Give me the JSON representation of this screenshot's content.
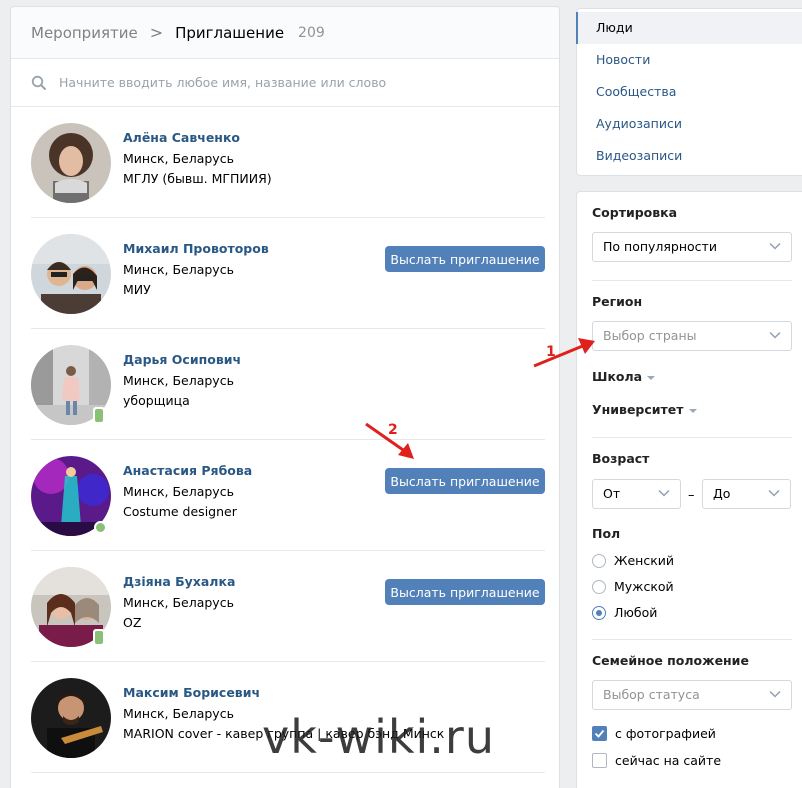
{
  "header": {
    "parent": "Мероприятие",
    "separator": ">",
    "current": "Приглашение",
    "count": "209"
  },
  "search": {
    "placeholder": "Начните вводить любое имя, название или слово"
  },
  "people": [
    {
      "name": "Алёна Савченко",
      "city": "Минск, Беларусь",
      "extra": "МГЛУ (бывш. МГПИИЯ)",
      "button": "",
      "badge": "none"
    },
    {
      "name": "Михаил Провоторов",
      "city": "Минск, Беларусь",
      "extra": "МИУ",
      "button": "Выслать приглашение",
      "badge": "none"
    },
    {
      "name": "Дарья Осипович",
      "city": "Минск, Беларусь",
      "extra": "уборщица",
      "button": "",
      "badge": "mobile"
    },
    {
      "name": "Анастасия Рябова",
      "city": "Минск, Беларусь",
      "extra": "Costume designer",
      "button": "Выслать приглашение",
      "badge": "online"
    },
    {
      "name": "Дзіяна Бухалка",
      "city": "Минск, Беларусь",
      "extra": "OZ",
      "button": "Выслать приглашение",
      "badge": "mobile"
    },
    {
      "name": "Максим Борисевич",
      "city": "Минск, Беларусь",
      "extra": "MARION cover - кавер группа | кавер бэнд Минск",
      "button": "",
      "badge": "none"
    }
  ],
  "menu": {
    "items": [
      "Люди",
      "Новости",
      "Сообщества",
      "Аудиозаписи",
      "Видеозаписи"
    ],
    "active": "Люди"
  },
  "filters": {
    "sort_title": "Сортировка",
    "sort_value": "По популярности",
    "region_title": "Регион",
    "region_placeholder": "Выбор страны",
    "school": "Школа",
    "university": "Университет",
    "age_title": "Возраст",
    "age_from": "От",
    "age_dash": "–",
    "age_to": "До",
    "gender_title": "Пол",
    "gender_options": [
      "Женский",
      "Мужской",
      "Любой"
    ],
    "gender_selected": "Любой",
    "family_title": "Семейное положение",
    "family_placeholder": "Выбор статуса",
    "with_photo": "с фотографией",
    "with_photo_checked": true,
    "online_now": "сейчас на сайте",
    "online_now_checked": false
  },
  "annotations": {
    "marker_1": "1",
    "marker_2": "2",
    "arrow_color": "#e0201c"
  },
  "watermark": "vk-wiki.ru",
  "colors": {
    "link": "#2a5885",
    "button": "#5181b8",
    "online": "#8ac176",
    "background": "#edeef0"
  }
}
